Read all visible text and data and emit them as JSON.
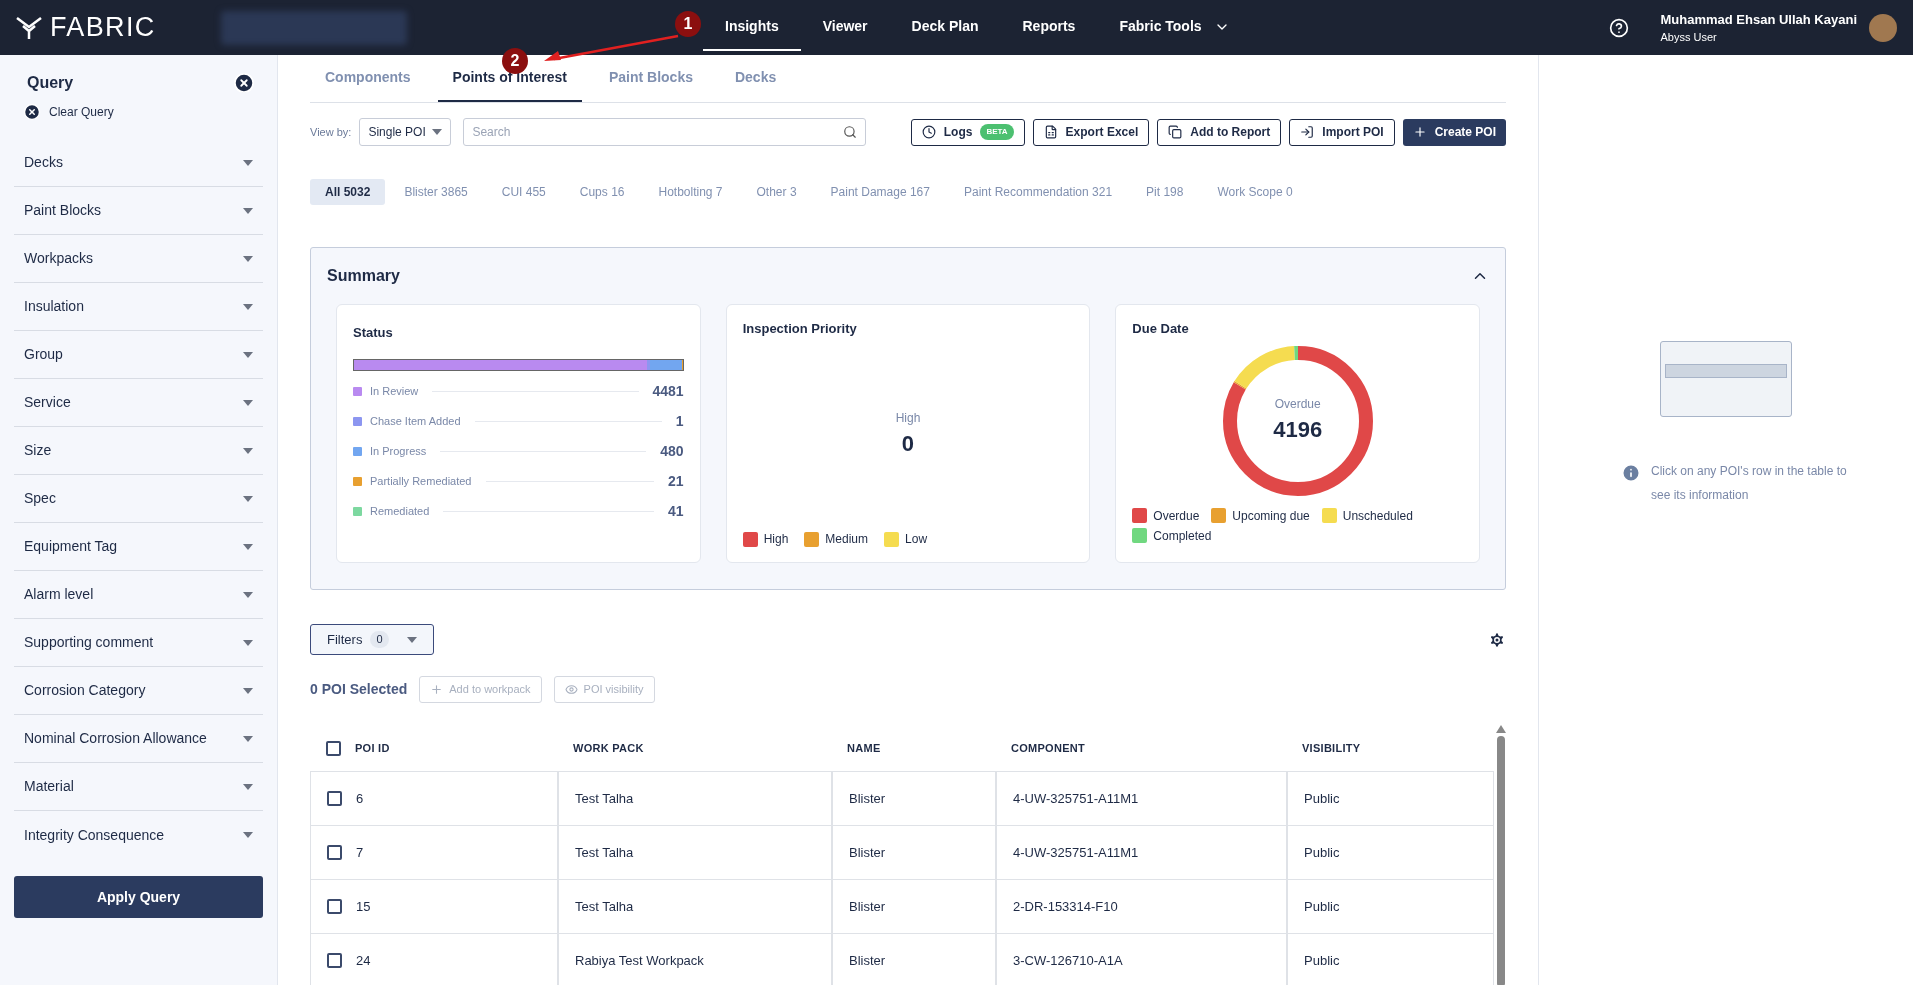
{
  "topbar": {
    "logo": "FABRIC",
    "nav": [
      {
        "label": "Insights",
        "selected": true
      },
      {
        "label": "Viewer",
        "selected": false
      },
      {
        "label": "Deck Plan",
        "selected": false
      },
      {
        "label": "Reports",
        "selected": false
      },
      {
        "label": "Fabric Tools",
        "selected": false,
        "dropdown": true
      }
    ],
    "user": {
      "name": "Muhammad Ehsan Ullah Kayani",
      "role": "Abyss User"
    }
  },
  "annotations": [
    {
      "label": "1"
    },
    {
      "label": "2"
    }
  ],
  "sidebar": {
    "title": "Query",
    "clear": "Clear Query",
    "filters": [
      "Decks",
      "Paint Blocks",
      "Workpacks",
      "Insulation",
      "Group",
      "Service",
      "Size",
      "Spec",
      "Equipment Tag",
      "Alarm level",
      "Supporting comment",
      "Corrosion Category",
      "Nominal Corrosion Allowance",
      "Material",
      "Integrity Consequence"
    ],
    "apply": "Apply Query"
  },
  "tabs": [
    {
      "label": "Components",
      "selected": false
    },
    {
      "label": "Points of Interest",
      "selected": true
    },
    {
      "label": "Paint Blocks",
      "selected": false
    },
    {
      "label": "Decks",
      "selected": false
    }
  ],
  "toolbar": {
    "view_by_label": "View by:",
    "view_by_value": "Single POI",
    "search_placeholder": "Search",
    "logs": "Logs",
    "logs_badge": "BETA",
    "export": "Export Excel",
    "add_report": "Add to Report",
    "import": "Import POI",
    "create": "Create POI"
  },
  "categories": [
    {
      "label": "All 5032",
      "selected": true
    },
    {
      "label": "Blister 3865",
      "selected": false
    },
    {
      "label": "CUI 455",
      "selected": false
    },
    {
      "label": "Cups 16",
      "selected": false
    },
    {
      "label": "Hotbolting 7",
      "selected": false
    },
    {
      "label": "Other 3",
      "selected": false
    },
    {
      "label": "Paint Damage 167",
      "selected": false
    },
    {
      "label": "Paint Recommendation 321",
      "selected": false
    },
    {
      "label": "Pit 198",
      "selected": false
    },
    {
      "label": "Work Scope 0",
      "selected": false
    }
  ],
  "summary": {
    "title": "Summary",
    "expanded": true,
    "status": {
      "title": "Status",
      "items": [
        {
          "label": "In Review",
          "value": "4481",
          "color": "#b98af0"
        },
        {
          "label": "Chase Item Added",
          "value": "1",
          "color": "#8c96f0"
        },
        {
          "label": "In Progress",
          "value": "480",
          "color": "#72a6f0"
        },
        {
          "label": "Partially Remediated",
          "value": "21",
          "color": "#e8a030"
        },
        {
          "label": "Remediated",
          "value": "41",
          "color": "#7dd8a0"
        }
      ]
    },
    "priority": {
      "title": "Inspection Priority",
      "center_label": "High",
      "center_value": "0",
      "legend": [
        {
          "label": "High",
          "color": "#e04848"
        },
        {
          "label": "Medium",
          "color": "#e8a030"
        },
        {
          "label": "Low",
          "color": "#f5dc50"
        }
      ]
    },
    "due": {
      "title": "Due Date",
      "center_label": "Overdue",
      "center_value": "4196",
      "legend": [
        {
          "label": "Overdue",
          "color": "#e04848"
        },
        {
          "label": "Upcoming due",
          "color": "#e8a030"
        },
        {
          "label": "Unscheduled",
          "color": "#f5dc50"
        },
        {
          "label": "Completed",
          "color": "#70d880"
        }
      ]
    }
  },
  "filters": {
    "label": "Filters",
    "count": "0"
  },
  "selection": {
    "text": "0 POI Selected",
    "add_workpack": "Add to workpack",
    "visibility": "POI visibility"
  },
  "table": {
    "all_checked": false,
    "columns": [
      "POI ID",
      "WORK PACK",
      "NAME",
      "COMPONENT",
      "VISIBILITY"
    ],
    "rows": [
      {
        "checked": false,
        "cells": [
          "6",
          "Test Talha",
          "Blister",
          "4-UW-325751-A11M1",
          "Public"
        ]
      },
      {
        "checked": false,
        "cells": [
          "7",
          "Test Talha",
          "Blister",
          "4-UW-325751-A11M1",
          "Public"
        ]
      },
      {
        "checked": false,
        "cells": [
          "15",
          "Test Talha",
          "Blister",
          "2-DR-153314-F10",
          "Public"
        ]
      },
      {
        "checked": false,
        "cells": [
          "24",
          "Rabiya Test Workpack",
          "Blister",
          "3-CW-126710-A1A",
          "Public"
        ]
      }
    ]
  },
  "detail_panel": {
    "hint": "Click on any POI's row in the table to see its information"
  }
}
